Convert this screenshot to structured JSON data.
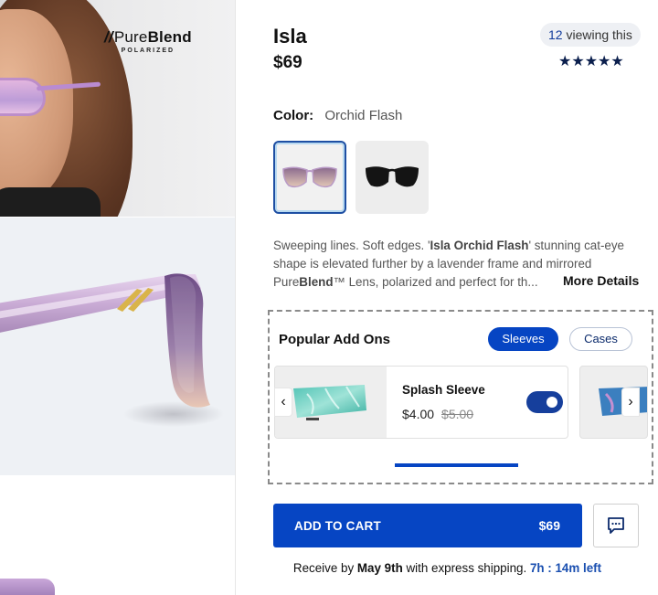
{
  "brand": {
    "name_prefix": "//",
    "name_a": "Pure",
    "name_b": "Blend",
    "sub": "POLARIZED"
  },
  "product": {
    "title": "Isla",
    "price": "$69",
    "viewing_count": "12",
    "viewing_text": " viewing this",
    "rating_stars": "★★★★★",
    "rating_value": 5,
    "color_label": "Color:",
    "color_value": "Orchid Flash",
    "description_1": "Sweeping lines. Soft edges. '",
    "description_bold": "Isla Orchid Flash",
    "description_2": "' stunning cat-eye shape is elevated further by a lavender frame and mirrored Pure",
    "description_bold_2": "Blend",
    "description_3": "™ Lens, polarized and perfect for th...",
    "more_details": "More Details"
  },
  "addons": {
    "title": "Popular Add Ons",
    "tabs": [
      {
        "label": "Sleeves",
        "active": true
      },
      {
        "label": "Cases",
        "active": false
      }
    ],
    "items": [
      {
        "name": "Splash Sleeve",
        "price": "$4.00",
        "old_price": "$5.00",
        "enabled": true
      }
    ],
    "prev_arrow": "‹",
    "next_arrow": "›"
  },
  "cart": {
    "label": "ADD TO CART",
    "price": "$69"
  },
  "shipping": {
    "prefix": "Receive by ",
    "date": "May 9th",
    "middle": " with express shipping. ",
    "timer": "7h : 14m left"
  },
  "colors": {
    "accent": "#0645c3",
    "navy": "#163f9c",
    "star": "#0b1f4d",
    "timer": "#1a4fb0"
  },
  "icons": {
    "chat": "chat-bubble-icon",
    "prev": "chevron-left-icon",
    "next": "chevron-right-icon"
  }
}
